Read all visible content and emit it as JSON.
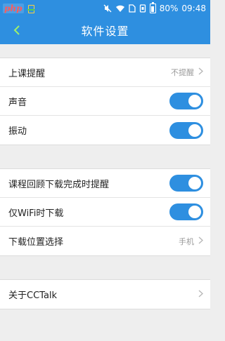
{
  "status_bar": {
    "logo_text": "php",
    "battery": "80%",
    "time": "09:48",
    "icons": [
      "mute-icon",
      "wifi-icon",
      "sim-icon",
      "rotate-icon",
      "battery-icon"
    ]
  },
  "nav": {
    "back_icon": "chevron-left-icon",
    "title": "软件设置"
  },
  "group1": {
    "items": [
      {
        "label": "上课提醒",
        "value": "不提醒",
        "control": "chevron"
      },
      {
        "label": "声音",
        "control": "toggle",
        "on": true
      },
      {
        "label": "振动",
        "control": "toggle",
        "on": true
      }
    ]
  },
  "group2": {
    "items": [
      {
        "label": "课程回顾下载完成时提醒",
        "control": "toggle",
        "on": true
      },
      {
        "label": "仅WiFi时下载",
        "control": "toggle",
        "on": true
      },
      {
        "label": "下载位置选择",
        "value": "手机",
        "control": "chevron"
      }
    ]
  },
  "group3": {
    "items": [
      {
        "label": "关于CCTalk",
        "control": "chevron"
      }
    ]
  },
  "colors": {
    "accent": "#2e8fe0",
    "back_icon": "#9ff06a",
    "background": "#eeeeee"
  }
}
